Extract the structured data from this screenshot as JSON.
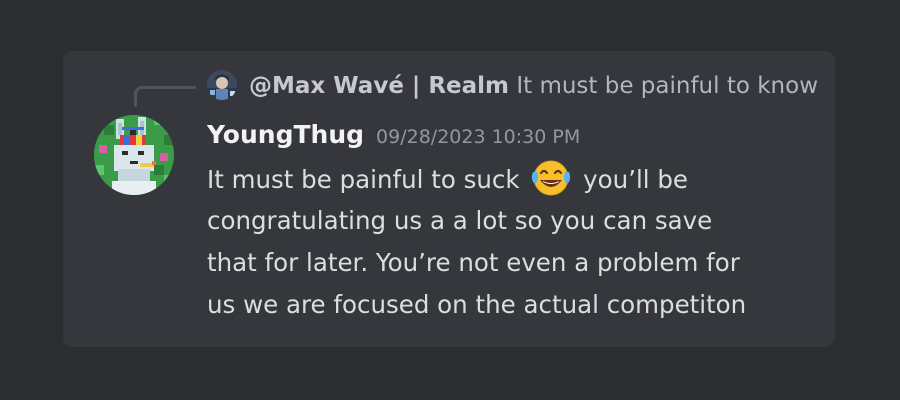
{
  "reply": {
    "author": "@Max Wavé | Realm",
    "text": "It must be painful to know",
    "avatar_icon": "reply-user-avatar"
  },
  "message": {
    "username": "YoungThug",
    "timestamp": "09/28/2023 10:30 PM",
    "avatar_icon": "pixel-bunny-avatar",
    "line1_before": "It must be painful to suck",
    "emoji": "face-with-tears-of-joy-icon",
    "line1_after": "you’ll be",
    "line2": "congratulating us a a lot so you can save",
    "line3": "that for later.  You’re not even a problem for",
    "line4": "us we are focused on the actual competiton"
  },
  "colors": {
    "background": "#2b2d31",
    "card": "#36373d",
    "username": "#f2f3f5",
    "text": "#dbdee1",
    "muted": "#9497a0"
  }
}
